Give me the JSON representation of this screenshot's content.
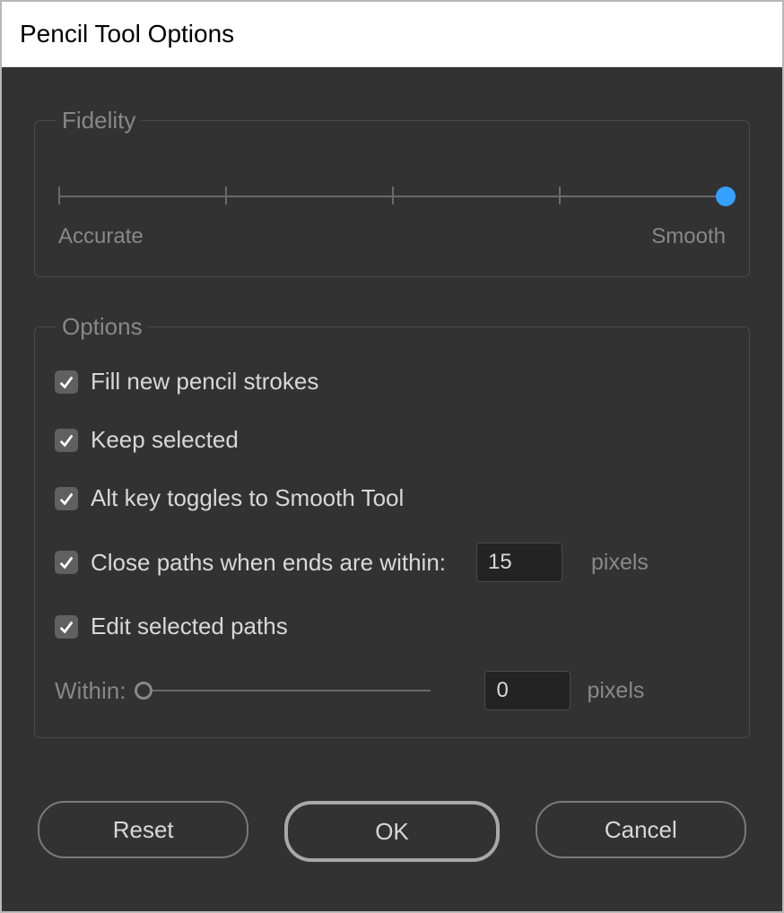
{
  "dialog": {
    "title": "Pencil Tool Options"
  },
  "fidelity": {
    "legend": "Fidelity",
    "left_label": "Accurate",
    "right_label": "Smooth",
    "ticks": 5,
    "value_position": 1.0
  },
  "options": {
    "legend": "Options",
    "fill_strokes": {
      "label": "Fill new pencil strokes",
      "checked": true
    },
    "keep_selected": {
      "label": "Keep selected",
      "checked": true
    },
    "alt_smooth": {
      "label": "Alt key toggles to Smooth Tool",
      "checked": true
    },
    "close_paths": {
      "label": "Close paths when ends are within:",
      "checked": true,
      "value": "15",
      "unit": "pixels"
    },
    "edit_selected": {
      "label": "Edit selected paths",
      "checked": true
    },
    "within": {
      "label": "Within:",
      "value": "0",
      "unit": "pixels",
      "slider_position": 0.0
    }
  },
  "buttons": {
    "reset": "Reset",
    "ok": "OK",
    "cancel": "Cancel"
  }
}
